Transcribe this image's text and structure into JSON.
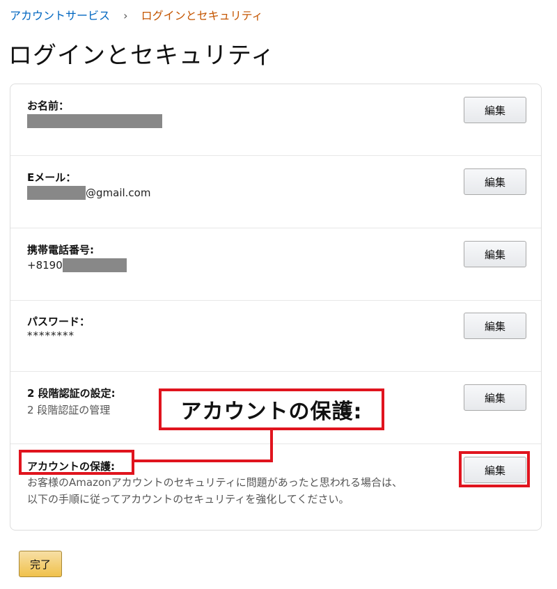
{
  "breadcrumb": {
    "parent": "アカウントサービス",
    "separator": "›",
    "current": "ログインとセキュリティ"
  },
  "page_title": "ログインとセキュリティ",
  "rows": [
    {
      "label": "お名前：",
      "value": ""
    },
    {
      "label": "Eメール：",
      "value": "@gmail.com"
    },
    {
      "label": "携帯電話番号:",
      "value": "+8190"
    },
    {
      "label": "パスワード：",
      "value": "********"
    },
    {
      "label": "2 段階認証の設定:",
      "value": "2 段階認証の管理"
    },
    {
      "label": "アカウントの保護:",
      "desc1": "お客様のAmazonアカウントのセキュリティに問題があったと思われる場合は、",
      "desc2": "以下の手順に従ってアカウントのセキュリティを強化してください。"
    }
  ],
  "edit_label": "編集",
  "callout_text": "アカウントの保護:",
  "done_label": "完了",
  "colors": {
    "link": "#0066c0",
    "current": "#c45500",
    "highlight": "#e0141e",
    "primary_button": "#f0c14b"
  }
}
